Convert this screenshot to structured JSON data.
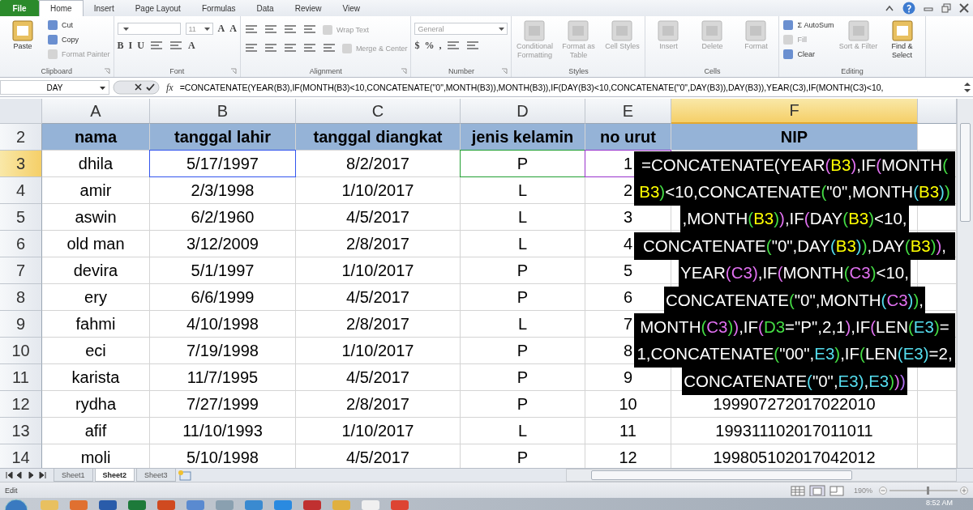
{
  "ribbon_tabs": [
    {
      "label": "File",
      "kind": "file",
      "selected": false
    },
    {
      "label": "Home",
      "kind": "tab",
      "selected": true
    },
    {
      "label": "Insert",
      "kind": "tab",
      "selected": false
    },
    {
      "label": "Page Layout",
      "kind": "tab",
      "selected": false
    },
    {
      "label": "Formulas",
      "kind": "tab",
      "selected": false
    },
    {
      "label": "Data",
      "kind": "tab",
      "selected": false
    },
    {
      "label": "Review",
      "kind": "tab",
      "selected": false
    },
    {
      "label": "View",
      "kind": "tab",
      "selected": false
    }
  ],
  "ribbon_groups": [
    {
      "label": "Clipboard",
      "kind": "columns",
      "launcher": true,
      "parts": [
        [
          {
            "kind": "large",
            "label": "Paste",
            "disabled": false
          }
        ],
        [
          {
            "kind": "small",
            "label": "Cut",
            "disabled": false
          },
          {
            "kind": "small",
            "label": "Copy",
            "disabled": false
          },
          {
            "kind": "small",
            "label": "Format Painter",
            "disabled": true
          }
        ]
      ]
    },
    {
      "label": "Font",
      "kind": "rows",
      "launcher": true,
      "parts": [
        [
          {
            "kind": "field"
          },
          {
            "kind": "field",
            "label": "11"
          },
          {
            "kind": "glyph",
            "label": "A"
          },
          {
            "kind": "glyph",
            "label": "A"
          }
        ],
        [
          {
            "kind": "glyph",
            "label": "B"
          },
          {
            "kind": "glyph",
            "label": "I"
          },
          {
            "kind": "glyph",
            "label": "U"
          },
          {
            "kind": "icon"
          },
          {
            "kind": "icon"
          },
          {
            "kind": "glyph",
            "label": "A"
          }
        ]
      ]
    },
    {
      "label": "Alignment",
      "kind": "rows",
      "launcher": true,
      "parts": [
        [
          {
            "kind": "icon"
          },
          {
            "kind": "icon"
          },
          {
            "kind": "icon"
          },
          {
            "kind": "icon"
          },
          {
            "kind": "small",
            "label": "Wrap Text",
            "disabled": true
          }
        ],
        [
          {
            "kind": "icon"
          },
          {
            "kind": "icon"
          },
          {
            "kind": "icon"
          },
          {
            "kind": "icon"
          },
          {
            "kind": "icon"
          },
          {
            "kind": "small",
            "label": "Merge & Center",
            "disabled": true
          }
        ]
      ]
    },
    {
      "label": "Number",
      "kind": "rows",
      "launcher": true,
      "parts": [
        [
          {
            "kind": "field",
            "label": "General"
          }
        ],
        [
          {
            "kind": "glyph",
            "label": "$"
          },
          {
            "kind": "glyph",
            "label": "%"
          },
          {
            "kind": "glyph",
            "label": ","
          },
          {
            "kind": "icon"
          },
          {
            "kind": "icon"
          }
        ]
      ]
    },
    {
      "label": "Styles",
      "kind": "columns",
      "launcher": false,
      "parts": [
        [
          {
            "kind": "large",
            "label": "Conditional Formatting",
            "disabled": true
          }
        ],
        [
          {
            "kind": "large",
            "label": "Format as Table",
            "disabled": true
          }
        ],
        [
          {
            "kind": "large",
            "label": "Cell Styles",
            "disabled": true
          }
        ]
      ]
    },
    {
      "label": "Cells",
      "kind": "columns",
      "launcher": false,
      "parts": [
        [
          {
            "kind": "large",
            "label": "Insert",
            "disabled": true
          }
        ],
        [
          {
            "kind": "large",
            "label": "Delete",
            "disabled": true
          }
        ],
        [
          {
            "kind": "large",
            "label": "Format",
            "disabled": true
          }
        ]
      ]
    },
    {
      "label": "Editing",
      "kind": "columns",
      "launcher": false,
      "parts": [
        [
          {
            "kind": "small",
            "label": "Σ AutoSum",
            "disabled": false
          },
          {
            "kind": "small",
            "label": "Fill",
            "disabled": true
          },
          {
            "kind": "small",
            "label": "Clear",
            "disabled": false
          }
        ],
        [
          {
            "kind": "large",
            "label": "Sort & Filter",
            "disabled": true
          }
        ],
        [
          {
            "kind": "large",
            "label": "Find & Select",
            "disabled": false
          }
        ]
      ]
    }
  ],
  "formula_bar": {
    "name_box": "DAY",
    "function_button": "fx",
    "formula": "=CONCATENATE(YEAR(B3),IF(MONTH(B3)<10,CONCATENATE(\"0\",MONTH(B3)),MONTH(B3)),IF(DAY(B3)<10,CONCATENATE(\"0\",DAY(B3)),DAY(B3)),YEAR(C3),IF(MONTH(C3)<10,"
  },
  "columns": [
    {
      "label": "A",
      "selected": false
    },
    {
      "label": "B",
      "selected": false
    },
    {
      "label": "C",
      "selected": false
    },
    {
      "label": "D",
      "selected": false
    },
    {
      "label": "E",
      "selected": false
    },
    {
      "label": "F",
      "selected": true
    }
  ],
  "rows": [
    {
      "number": "2",
      "selected": false,
      "kind": "heading",
      "cells": [
        {
          "text": "nama"
        },
        {
          "text": "tanggal lahir"
        },
        {
          "text": "tanggal diangkat"
        },
        {
          "text": "jenis kelamin"
        },
        {
          "text": "no urut"
        },
        {
          "text": "NIP"
        }
      ]
    },
    {
      "number": "3",
      "selected": true,
      "kind": "data",
      "cells": [
        {
          "text": "dhila"
        },
        {
          "text": "5/17/1997",
          "color": "#3355ee"
        },
        {
          "text": "8/2/2017"
        },
        {
          "text": "P",
          "color": "#22a033"
        },
        {
          "text": "1",
          "color": "#9933cc"
        }
      ]
    },
    {
      "number": "4",
      "selected": false,
      "kind": "data",
      "cells": [
        {
          "text": "amir"
        },
        {
          "text": "2/3/1998"
        },
        {
          "text": "1/10/2017"
        },
        {
          "text": "L"
        },
        {
          "text": "2"
        }
      ]
    },
    {
      "number": "5",
      "selected": false,
      "kind": "data",
      "cells": [
        {
          "text": "aswin"
        },
        {
          "text": "6/2/1960"
        },
        {
          "text": "4/5/2017"
        },
        {
          "text": "L"
        },
        {
          "text": "3"
        }
      ]
    },
    {
      "number": "6",
      "selected": false,
      "kind": "data",
      "cells": [
        {
          "text": "old man"
        },
        {
          "text": "3/12/2009"
        },
        {
          "text": "2/8/2017"
        },
        {
          "text": "L"
        },
        {
          "text": "4"
        }
      ]
    },
    {
      "number": "7",
      "selected": false,
      "kind": "data",
      "cells": [
        {
          "text": "devira"
        },
        {
          "text": "5/1/1997"
        },
        {
          "text": "1/10/2017"
        },
        {
          "text": "P"
        },
        {
          "text": "5"
        }
      ]
    },
    {
      "number": "8",
      "selected": false,
      "kind": "data",
      "cells": [
        {
          "text": "ery"
        },
        {
          "text": "6/6/1999"
        },
        {
          "text": "4/5/2017"
        },
        {
          "text": "P"
        },
        {
          "text": "6"
        }
      ]
    },
    {
      "number": "9",
      "selected": false,
      "kind": "data",
      "cells": [
        {
          "text": "fahmi"
        },
        {
          "text": "4/10/1998"
        },
        {
          "text": "2/8/2017"
        },
        {
          "text": "L"
        },
        {
          "text": "7"
        }
      ]
    },
    {
      "number": "10",
      "selected": false,
      "kind": "data",
      "cells": [
        {
          "text": "eci"
        },
        {
          "text": "7/19/1998"
        },
        {
          "text": "1/10/2017"
        },
        {
          "text": "P"
        },
        {
          "text": "8"
        }
      ]
    },
    {
      "number": "11",
      "selected": false,
      "kind": "data",
      "cells": [
        {
          "text": "karista"
        },
        {
          "text": "11/7/1995"
        },
        {
          "text": "4/5/2017"
        },
        {
          "text": "P"
        },
        {
          "text": "9"
        }
      ]
    },
    {
      "number": "12",
      "selected": false,
      "kind": "data",
      "cells": [
        {
          "text": "rydha"
        },
        {
          "text": "7/27/1999"
        },
        {
          "text": "2/8/2017"
        },
        {
          "text": "P"
        },
        {
          "text": "10"
        },
        {
          "text": "199907272017022010"
        }
      ]
    },
    {
      "number": "13",
      "selected": false,
      "kind": "data",
      "cells": [
        {
          "text": "afif"
        },
        {
          "text": "11/10/1993"
        },
        {
          "text": "1/10/2017"
        },
        {
          "text": "L"
        },
        {
          "text": "11"
        },
        {
          "text": "199311102017011011"
        }
      ]
    },
    {
      "number": "14",
      "selected": false,
      "kind": "data",
      "cells": [
        {
          "text": "moli"
        },
        {
          "text": "5/10/1998"
        },
        {
          "text": "4/5/2017"
        },
        {
          "text": "P"
        },
        {
          "text": "12"
        },
        {
          "text": "199805102017042012"
        }
      ]
    }
  ],
  "formula_overlay": [
    [
      {
        "text": "=CONCATENATE(YEAR",
        "color": "#ffffff"
      },
      {
        "text": "(",
        "color": "#e070f0"
      },
      {
        "text": "B3",
        "color": "#ffff00"
      },
      {
        "text": ")",
        "color": "#e070f0"
      },
      {
        "text": ",IF",
        "color": "#ffffff"
      },
      {
        "text": "(",
        "color": "#e070f0"
      },
      {
        "text": "MONTH",
        "color": "#ffffff"
      },
      {
        "text": "(",
        "color": "#44dd44"
      }
    ],
    [
      {
        "text": "B3",
        "color": "#ffff00"
      },
      {
        "text": ")",
        "color": "#44dd44"
      },
      {
        "text": "<10,CONCATENATE",
        "color": "#ffffff"
      },
      {
        "text": "(",
        "color": "#44dd44"
      },
      {
        "text": "\"0\",MONTH",
        "color": "#ffffff"
      },
      {
        "text": "(",
        "color": "#55ddee"
      },
      {
        "text": "B3",
        "color": "#ffff00"
      },
      {
        "text": ")",
        "color": "#55ddee"
      },
      {
        "text": ")",
        "color": "#44dd44"
      }
    ],
    [
      {
        "text": ",MONTH",
        "color": "#ffffff"
      },
      {
        "text": "(",
        "color": "#44dd44"
      },
      {
        "text": "B3",
        "color": "#ffff00"
      },
      {
        "text": ")",
        "color": "#44dd44"
      },
      {
        "text": ")",
        "color": "#e070f0"
      },
      {
        "text": ",IF",
        "color": "#ffffff"
      },
      {
        "text": "(",
        "color": "#e070f0"
      },
      {
        "text": "DAY",
        "color": "#ffffff"
      },
      {
        "text": "(",
        "color": "#44dd44"
      },
      {
        "text": "B3",
        "color": "#ffff00"
      },
      {
        "text": ")",
        "color": "#44dd44"
      },
      {
        "text": "<10,",
        "color": "#ffffff"
      }
    ],
    [
      {
        "text": "CONCATENATE",
        "color": "#ffffff"
      },
      {
        "text": "(",
        "color": "#44dd44"
      },
      {
        "text": "\"0\",DAY",
        "color": "#ffffff"
      },
      {
        "text": "(",
        "color": "#55ddee"
      },
      {
        "text": "B3",
        "color": "#ffff00"
      },
      {
        "text": ")",
        "color": "#55ddee"
      },
      {
        "text": ")",
        "color": "#44dd44"
      },
      {
        "text": ",DAY",
        "color": "#ffffff"
      },
      {
        "text": "(",
        "color": "#44dd44"
      },
      {
        "text": "B3",
        "color": "#ffff00"
      },
      {
        "text": ")",
        "color": "#44dd44"
      },
      {
        "text": ")",
        "color": "#e070f0"
      },
      {
        "text": ",",
        "color": "#ffffff"
      }
    ],
    [
      {
        "text": "YEAR",
        "color": "#ffffff"
      },
      {
        "text": "(",
        "color": "#e070f0"
      },
      {
        "text": "C3",
        "color": "#e070f0"
      },
      {
        "text": ")",
        "color": "#e070f0"
      },
      {
        "text": ",IF",
        "color": "#ffffff"
      },
      {
        "text": "(",
        "color": "#e070f0"
      },
      {
        "text": "MONTH",
        "color": "#ffffff"
      },
      {
        "text": "(",
        "color": "#44dd44"
      },
      {
        "text": "C3",
        "color": "#e070f0"
      },
      {
        "text": ")",
        "color": "#44dd44"
      },
      {
        "text": "<10,",
        "color": "#ffffff"
      }
    ],
    [
      {
        "text": "CONCATENATE",
        "color": "#ffffff"
      },
      {
        "text": "(",
        "color": "#44dd44"
      },
      {
        "text": "\"0\",MONTH",
        "color": "#ffffff"
      },
      {
        "text": "(",
        "color": "#55ddee"
      },
      {
        "text": "C3",
        "color": "#e070f0"
      },
      {
        "text": ")",
        "color": "#55ddee"
      },
      {
        "text": ")",
        "color": "#44dd44"
      },
      {
        "text": ",",
        "color": "#ffffff"
      }
    ],
    [
      {
        "text": "MONTH",
        "color": "#ffffff"
      },
      {
        "text": "(",
        "color": "#44dd44"
      },
      {
        "text": "C3",
        "color": "#e070f0"
      },
      {
        "text": ")",
        "color": "#44dd44"
      },
      {
        "text": ")",
        "color": "#e070f0"
      },
      {
        "text": ",IF",
        "color": "#ffffff"
      },
      {
        "text": "(",
        "color": "#e070f0"
      },
      {
        "text": "D3",
        "color": "#44dd44"
      },
      {
        "text": "=\"P\",2,1",
        "color": "#ffffff"
      },
      {
        "text": ")",
        "color": "#e070f0"
      },
      {
        "text": ",IF",
        "color": "#ffffff"
      },
      {
        "text": "(",
        "color": "#e070f0"
      },
      {
        "text": "LEN",
        "color": "#ffffff"
      },
      {
        "text": "(",
        "color": "#44dd44"
      },
      {
        "text": "E3",
        "color": "#55ddee"
      },
      {
        "text": ")",
        "color": "#44dd44"
      },
      {
        "text": "=",
        "color": "#ffffff"
      }
    ],
    [
      {
        "text": "1,CONCATENATE",
        "color": "#ffffff"
      },
      {
        "text": "(",
        "color": "#44dd44"
      },
      {
        "text": "\"00\",",
        "color": "#ffffff"
      },
      {
        "text": "E3",
        "color": "#55ddee"
      },
      {
        "text": ")",
        "color": "#44dd44"
      },
      {
        "text": ",IF",
        "color": "#ffffff"
      },
      {
        "text": "(",
        "color": "#44dd44"
      },
      {
        "text": "LEN",
        "color": "#ffffff"
      },
      {
        "text": "(",
        "color": "#55ddee"
      },
      {
        "text": "E3",
        "color": "#55ddee"
      },
      {
        "text": ")",
        "color": "#55ddee"
      },
      {
        "text": "=2,",
        "color": "#ffffff"
      }
    ],
    [
      {
        "text": "CONCATENATE",
        "color": "#ffffff"
      },
      {
        "text": "(",
        "color": "#55ddee"
      },
      {
        "text": "\"0\",",
        "color": "#ffffff"
      },
      {
        "text": "E3",
        "color": "#55ddee"
      },
      {
        "text": ")",
        "color": "#55ddee"
      },
      {
        "text": ",",
        "color": "#ffffff"
      },
      {
        "text": "E3",
        "color": "#55ddee"
      },
      {
        "text": ")",
        "color": "#44dd44"
      },
      {
        "text": ")",
        "color": "#e070f0"
      },
      {
        "text": ")",
        "color": "#b070f0"
      }
    ]
  ],
  "sheet_tabs": [
    {
      "label": "Sheet1",
      "selected": false
    },
    {
      "label": "Sheet2",
      "selected": true
    },
    {
      "label": "Sheet3",
      "selected": false
    }
  ],
  "status_bar": {
    "mode": "Edit",
    "zoom": "190%",
    "zoom_level": {
      "level": 0.55
    }
  },
  "taskbar": {
    "clock": "8:52 AM"
  }
}
